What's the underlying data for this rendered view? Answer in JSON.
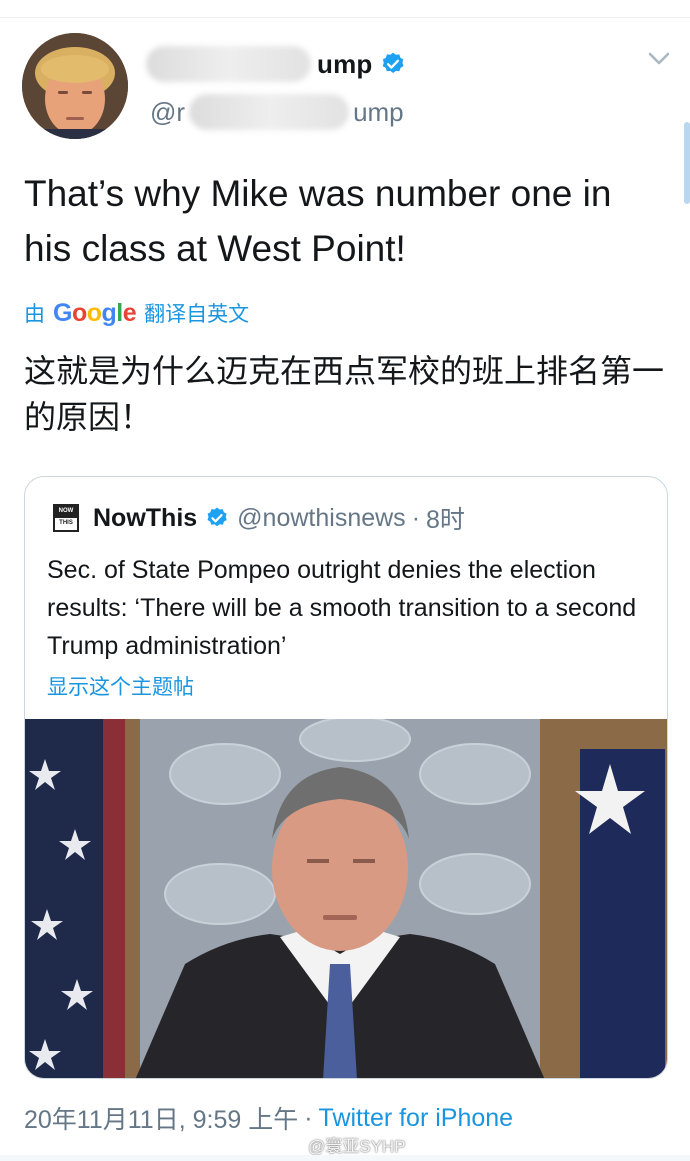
{
  "author": {
    "display_name_suffix": "ump",
    "handle_prefix": "@r",
    "handle_suffix": "ump",
    "verified_icon": "verified-badge-icon"
  },
  "tweet": {
    "text": "That’s why Mike was number one in his class at West Point!",
    "translated_prefix": "由",
    "translated_suffix": "翻译自英文",
    "google_letters": [
      "G",
      "o",
      "o",
      "g",
      "l",
      "e"
    ],
    "translation": "这就是为什么迈克在西点军校的班上排名第一的原因！"
  },
  "quoted": {
    "name": "NowThis",
    "handle": "@nowthisnews",
    "separator": "·",
    "time": "8时",
    "logo_top": "NOW",
    "logo_bottom": "THIS",
    "text": "Sec. of State Pompeo outright denies the election results: ‘There will be a smooth transition to a second Trump administration’",
    "show_thread": "显示这个主题帖"
  },
  "meta": {
    "timestamp": "20年11月11日, 9:59 上午",
    "separator": "·",
    "source": "Twitter for iPhone"
  },
  "watermark": {
    "text": "@寰亚SYHP"
  },
  "colors": {
    "link_blue": "#1b95e0",
    "text_primary": "#14171a",
    "text_secondary": "#657786",
    "border": "#ccd6dd"
  }
}
